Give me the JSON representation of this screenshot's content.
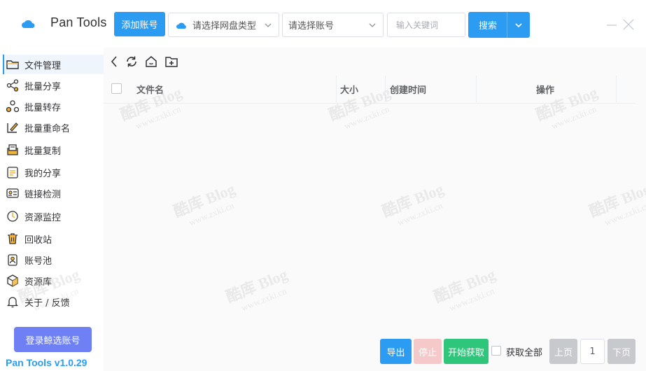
{
  "app": {
    "title": "Pan Tools",
    "version": "Pan Tools v1.0.29"
  },
  "toolbar": {
    "add_account_label": "添加账号",
    "disk_type_select": "请选择网盘类型",
    "account_select": "请选择账号",
    "keyword_placeholder": "输入关键词",
    "search_label": "搜索"
  },
  "sidebar": {
    "items": [
      {
        "label": "文件管理",
        "icon": "folder-icon",
        "active": true
      },
      {
        "label": "批量分享",
        "icon": "share-icon"
      },
      {
        "label": "批量转存",
        "icon": "transfer-icon"
      },
      {
        "label": "批量重命名",
        "icon": "rename-icon"
      },
      {
        "label": "批量复制",
        "icon": "copy-icon"
      },
      {
        "label": "我的分享",
        "icon": "my-share-icon"
      },
      {
        "label": "链接检测",
        "icon": "link-check-icon"
      },
      {
        "label": "资源监控",
        "icon": "monitor-icon"
      },
      {
        "label": "回收站",
        "icon": "trash-icon"
      },
      {
        "label": "账号池",
        "icon": "account-pool-icon"
      },
      {
        "label": "资源库",
        "icon": "resource-library-icon"
      },
      {
        "label": "关于 / 反馈",
        "icon": "bell-icon"
      }
    ],
    "login_button": "登录鲸选账号"
  },
  "table": {
    "columns": [
      "文件名",
      "大小",
      "创建时间",
      "操作"
    ],
    "rows": []
  },
  "footer": {
    "export_label": "导出",
    "stop_label": "停止",
    "start_label": "开始获取",
    "select_all_label": "获取全部",
    "prev_label": "上页",
    "page_number": "1",
    "next_label": "下页"
  },
  "watermark": {
    "brand": "酷库 Blog",
    "url": "www.zxki.cn"
  },
  "colors": {
    "primary": "#2b9cf2",
    "success": "#2fc57b",
    "danger_disabled": "#f5c9c9",
    "login": "#6f7ff4",
    "disabled": "#c8c9cc"
  }
}
